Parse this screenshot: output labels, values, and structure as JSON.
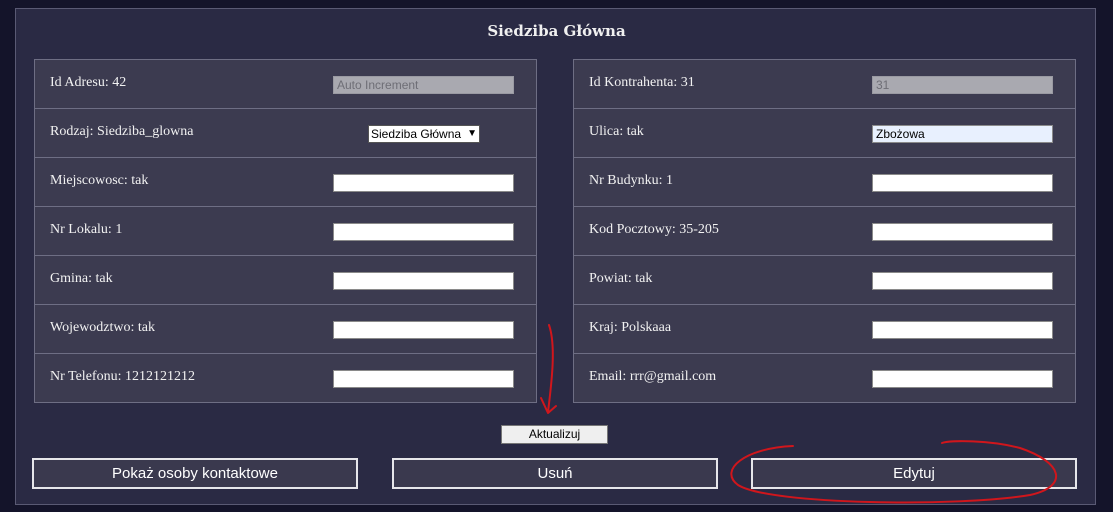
{
  "section_title": "Siedziba Główna",
  "left_rows": [
    {
      "label": "Id Adresu: 42",
      "field_type": "input",
      "value": "",
      "placeholder": "Auto Increment",
      "state": "disabled"
    },
    {
      "label": "Rodzaj: Siedziba_glowna",
      "field_type": "select",
      "value": "Siedziba Główna"
    },
    {
      "label": "Miejscowosc: tak",
      "field_type": "input",
      "value": ""
    },
    {
      "label": "Nr Lokalu: 1",
      "field_type": "input",
      "value": ""
    },
    {
      "label": "Gmina: tak",
      "field_type": "input",
      "value": ""
    },
    {
      "label": "Wojewodztwo: tak",
      "field_type": "input",
      "value": ""
    },
    {
      "label": "Nr Telefonu: 1212121212",
      "field_type": "input",
      "value": ""
    }
  ],
  "right_rows": [
    {
      "label": "Id Kontrahenta: 31",
      "field_type": "input",
      "value": "31",
      "state": "disabled"
    },
    {
      "label": "Ulica: tak",
      "field_type": "input",
      "value": "Zbożowa",
      "state": "autofill"
    },
    {
      "label": "Nr Budynku: 1",
      "field_type": "input",
      "value": ""
    },
    {
      "label": "Kod Pocztowy: 35-205",
      "field_type": "input",
      "value": ""
    },
    {
      "label": "Powiat: tak",
      "field_type": "input",
      "value": ""
    },
    {
      "label": "Kraj: Polskaaa",
      "field_type": "input",
      "value": ""
    },
    {
      "label": "Email: rrr@gmail.com",
      "field_type": "input",
      "value": ""
    }
  ],
  "buttons": {
    "update": "Aktualizuj",
    "contacts": "Pokaż osoby kontaktowe",
    "delete": "Usuń",
    "edit": "Edytuj"
  },
  "annotation_color": "#d0161c"
}
